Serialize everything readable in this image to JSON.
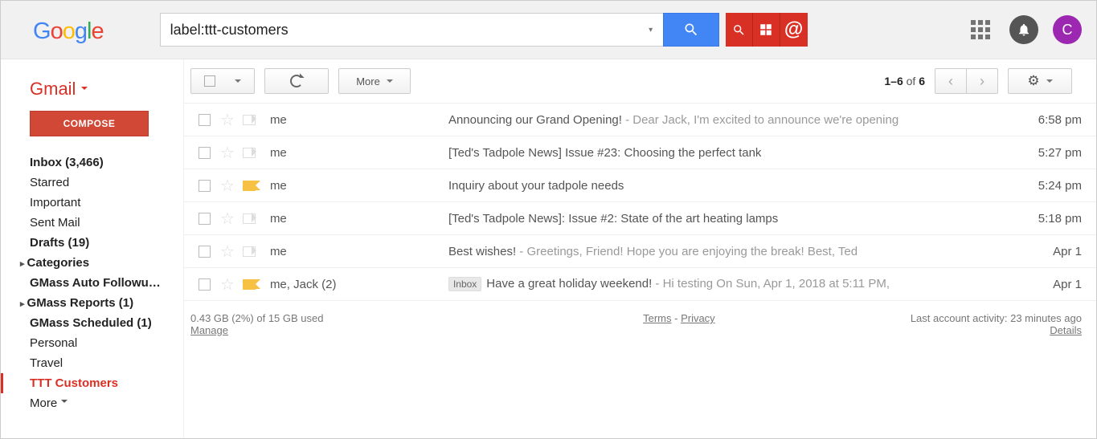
{
  "header": {
    "search_value": "label:ttt-customers",
    "avatar_letter": "C"
  },
  "sidebar": {
    "gmail_label": "Gmail",
    "compose_label": "COMPOSE",
    "items": [
      {
        "label": "Inbox (3,466)",
        "bold": true
      },
      {
        "label": "Starred"
      },
      {
        "label": "Important"
      },
      {
        "label": "Sent Mail"
      },
      {
        "label": "Drafts (19)",
        "bold": true
      },
      {
        "label": "Categories",
        "bold": true,
        "expandable": true
      },
      {
        "label": "GMass Auto Followu…",
        "bold": true
      },
      {
        "label": "GMass Reports (1)",
        "bold": true,
        "expandable": true
      },
      {
        "label": "GMass Scheduled (1)",
        "bold": true
      },
      {
        "label": "Personal"
      },
      {
        "label": "Travel"
      },
      {
        "label": "TTT Customers",
        "active": true
      },
      {
        "label": "More",
        "more": true
      }
    ]
  },
  "toolbar": {
    "more_label": "More",
    "pagination_a": "1–6",
    "pagination_of": " of ",
    "pagination_b": "6"
  },
  "emails": [
    {
      "sender": "me",
      "subject": "Announcing our Grand Opening!",
      "snippet": " - Dear Jack, I'm excited to announce we're opening",
      "time": "6:58 pm",
      "tag": false
    },
    {
      "sender": "me",
      "subject": "[Ted's Tadpole News] Issue #23: Choosing the perfect tank",
      "snippet": "",
      "time": "5:27 pm",
      "tag": false
    },
    {
      "sender": "me",
      "subject": "Inquiry about your tadpole needs",
      "snippet": "",
      "time": "5:24 pm",
      "tag": true
    },
    {
      "sender": "me",
      "subject": "[Ted's Tadpole News]: Issue #2: State of the art heating lamps",
      "snippet": "",
      "time": "5:18 pm",
      "tag": false
    },
    {
      "sender": "me",
      "subject": "Best wishes!",
      "snippet": " - Greetings, Friend! Hope you are enjoying the break! Best, Ted",
      "time": "Apr 1",
      "tag": false
    },
    {
      "sender": "me, Jack (2)",
      "subject": "Have a great holiday weekend!",
      "snippet": " - Hi testing On Sun, Apr 1, 2018 at 5:11 PM,",
      "time": "Apr 1",
      "tag": true,
      "inbox": true
    }
  ],
  "footer": {
    "storage": "0.43 GB (2%) of 15 GB used",
    "manage": "Manage",
    "terms": "Terms",
    "privacy": "Privacy",
    "dash": " - ",
    "activity": "Last account activity: 23 minutes ago",
    "details": "Details"
  },
  "inbox_badge_label": "Inbox"
}
